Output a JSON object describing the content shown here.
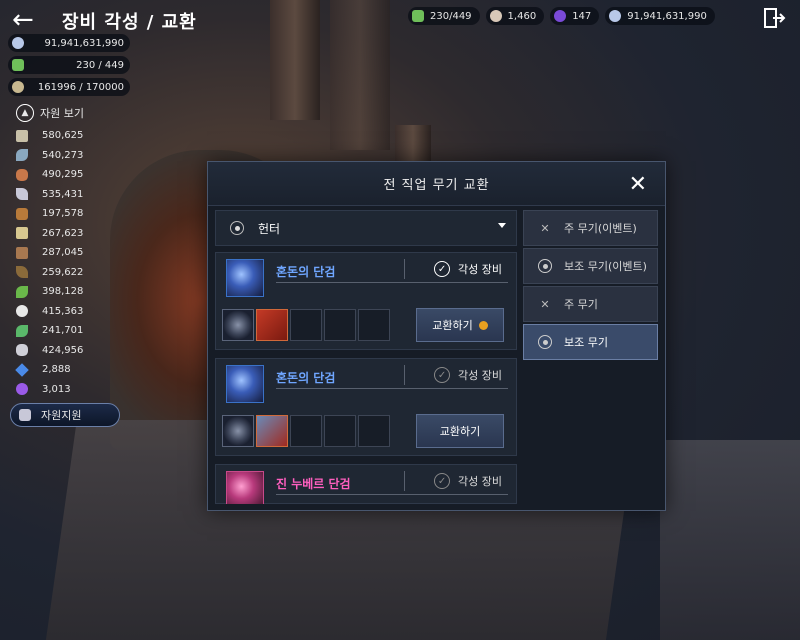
{
  "header": {
    "title": "장비 각성 / 교환"
  },
  "topbar": {
    "items": [
      {
        "icon": "green-stone-icon",
        "color": "#6fbf5a",
        "value": "230/449"
      },
      {
        "icon": "pearl-icon",
        "color": "#d8c8b8",
        "value": "1,460"
      },
      {
        "icon": "purple-orb-icon",
        "color": "#7a4ad8",
        "value": "147"
      },
      {
        "icon": "diamond-icon",
        "color": "#b8c8e8",
        "value": "91,941,631,990"
      }
    ]
  },
  "left": {
    "pills": [
      {
        "icon": "diamond-icon",
        "color": "#b8c8e8",
        "value": "91,941,631,990"
      },
      {
        "icon": "green-stone-icon",
        "color": "#6fbf5a",
        "value": "230 / 449"
      },
      {
        "icon": "wheat-icon",
        "color": "#c8b890",
        "value": "161996 / 170000"
      }
    ],
    "resource_view_label": "자원 보기",
    "resources": [
      {
        "icon": "ore-icon",
        "color": "#c8c0a8",
        "value": "580,625"
      },
      {
        "icon": "leaf-icon",
        "color": "#8aa8c0",
        "value": "540,273"
      },
      {
        "icon": "meat-icon",
        "color": "#c8784a",
        "value": "490,295"
      },
      {
        "icon": "feather-icon",
        "color": "#c8c8d8",
        "value": "535,431"
      },
      {
        "icon": "wood-icon",
        "color": "#b87a3a",
        "value": "197,578"
      },
      {
        "icon": "bone-icon",
        "color": "#d8c890",
        "value": "267,623"
      },
      {
        "icon": "claw-icon",
        "color": "#a87850",
        "value": "287,045"
      },
      {
        "icon": "horn-icon",
        "color": "#8a6a3a",
        "value": "259,622"
      },
      {
        "icon": "herb-icon",
        "color": "#6ab84a",
        "value": "398,128"
      },
      {
        "icon": "flower-icon",
        "color": "#e8e8e8",
        "value": "415,363"
      },
      {
        "icon": "grass-icon",
        "color": "#5ab86a",
        "value": "241,701"
      },
      {
        "icon": "stone-icon",
        "color": "#d0d0d8",
        "value": "424,956"
      },
      {
        "icon": "crystal-icon",
        "color": "#4a8ae8",
        "value": "2,888"
      },
      {
        "icon": "gem-icon",
        "color": "#9a5ae8",
        "value": "3,013"
      }
    ],
    "support_label": "자원지원"
  },
  "modal": {
    "title": "전 직업 무기 교환",
    "class_selected": "헌터",
    "items": [
      {
        "name": "혼돈의 단검",
        "awaken_label": "각성 장비",
        "button": "교환하기",
        "has_coin": true
      },
      {
        "name": "혼돈의 단검",
        "awaken_label": "각성 장비",
        "button": "교환하기",
        "has_coin": false
      },
      {
        "name": "진 누베르 단검",
        "awaken_label": "각성 장비"
      }
    ],
    "tabs": [
      {
        "label": "주 무기(이벤트)",
        "icon": "swords-icon"
      },
      {
        "label": "보조 무기(이벤트)",
        "icon": "ring-icon"
      },
      {
        "label": "주 무기",
        "icon": "swords-icon"
      },
      {
        "label": "보조 무기",
        "icon": "ring-icon",
        "active": true
      }
    ]
  }
}
